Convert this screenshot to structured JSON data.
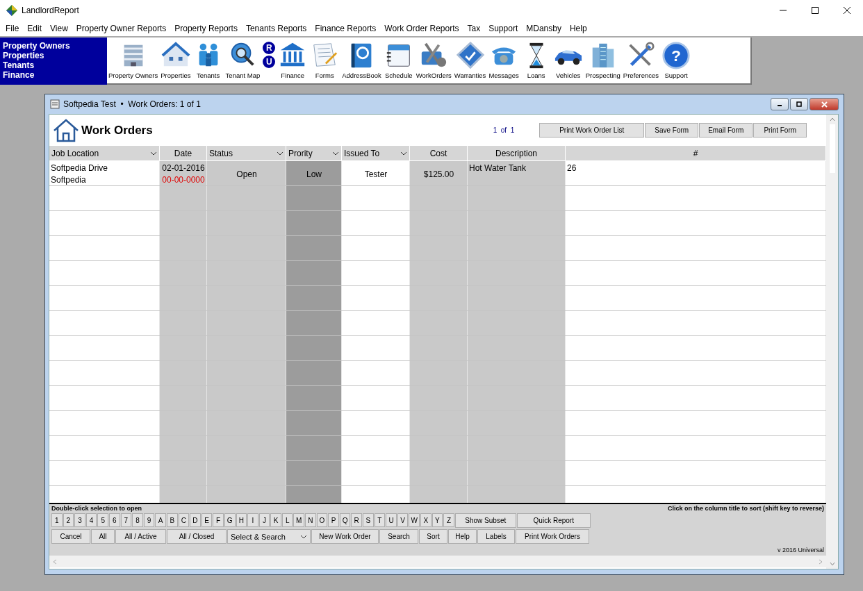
{
  "window": {
    "title": "LandlordReport"
  },
  "menu": [
    "File",
    "Edit",
    "View",
    "Property Owner Reports",
    "Property Reports",
    "Tenants Reports",
    "Finance Reports",
    "Work Order Reports",
    "Tax",
    "Support",
    "MDansby",
    "Help"
  ],
  "toolbar": {
    "links": [
      "Property Owners",
      "Properties",
      "Tenants",
      "Finance"
    ],
    "items": [
      {
        "kind": "tool",
        "label": "Property Owners"
      },
      {
        "kind": "tool",
        "label": "Properties"
      },
      {
        "kind": "tool",
        "label": "Tenants"
      },
      {
        "kind": "tool",
        "label": "Tenant Map"
      },
      {
        "kind": "badges",
        "letters": [
          "R",
          "U"
        ]
      },
      {
        "kind": "tool",
        "label": "Finance"
      },
      {
        "kind": "tool",
        "label": "Forms"
      },
      {
        "kind": "tool",
        "label": "AddressBook"
      },
      {
        "kind": "tool",
        "label": "Schedule"
      },
      {
        "kind": "tool",
        "label": "WorkOrders"
      },
      {
        "kind": "tool",
        "label": "Warranties"
      },
      {
        "kind": "tool",
        "label": "Messages"
      },
      {
        "kind": "tool",
        "label": "Loans"
      },
      {
        "kind": "tool",
        "label": "Vehicles"
      },
      {
        "kind": "tool",
        "label": "Prospecting"
      },
      {
        "kind": "tool",
        "label": "Preferences"
      },
      {
        "kind": "tool",
        "label": "Support",
        "glyph": "?"
      }
    ]
  },
  "child_window": {
    "title": "Softpedia Test  •  Work Orders: 1 of 1",
    "heading": "Work Orders",
    "pager": {
      "current": "1",
      "of": "of",
      "total": "1"
    },
    "buttons": [
      "Print Work Order List",
      "Save Form",
      "Email Form",
      "Print Form"
    ],
    "columns": [
      {
        "label": "Job Location",
        "dropdown": true,
        "kind": "white"
      },
      {
        "label": "Date",
        "dropdown": false,
        "kind": "shaded"
      },
      {
        "label": "Status",
        "dropdown": true,
        "kind": "shaded"
      },
      {
        "label": "Prority",
        "dropdown": true,
        "kind": "dark"
      },
      {
        "label": "Issued To",
        "dropdown": true,
        "kind": "white"
      },
      {
        "label": "Cost",
        "dropdown": false,
        "kind": "shaded"
      },
      {
        "label": "Description",
        "dropdown": false,
        "kind": "shaded"
      },
      {
        "label": "#",
        "dropdown": false,
        "kind": "white"
      }
    ],
    "rows": [
      {
        "job_location": [
          "Softpedia Drive",
          "Softpedia"
        ],
        "date": "02-01-2016",
        "date_due": "00-00-0000",
        "status": "Open",
        "priority": "Low",
        "issued_to": "Tester",
        "cost": "$125.00",
        "description": "Hot Water Tank",
        "number": "26"
      }
    ],
    "footer": {
      "hint": "Double-click selection to open",
      "sort_hint": "Click on the column title to sort (shift key to reverse)",
      "letters": [
        "1",
        "2",
        "3",
        "4",
        "5",
        "6",
        "7",
        "8",
        "9",
        "A",
        "B",
        "C",
        "D",
        "E",
        "F",
        "G",
        "H",
        "I",
        "J",
        "K",
        "L",
        "M",
        "N",
        "O",
        "P",
        "Q",
        "R",
        "S",
        "T",
        "U",
        "V",
        "W",
        "X",
        "Y",
        "Z"
      ],
      "row1_buttons": [
        "Show Subset",
        "Quick Report"
      ],
      "row2_left": [
        "Cancel",
        "All",
        "All / Active",
        "All / Closed"
      ],
      "select": {
        "value": "Select & Search"
      },
      "row2_right": [
        "New Work Order",
        "Search",
        "Sort",
        "Help",
        "Labels",
        "Print Work Orders"
      ],
      "version": "v 2016 Universal"
    }
  }
}
